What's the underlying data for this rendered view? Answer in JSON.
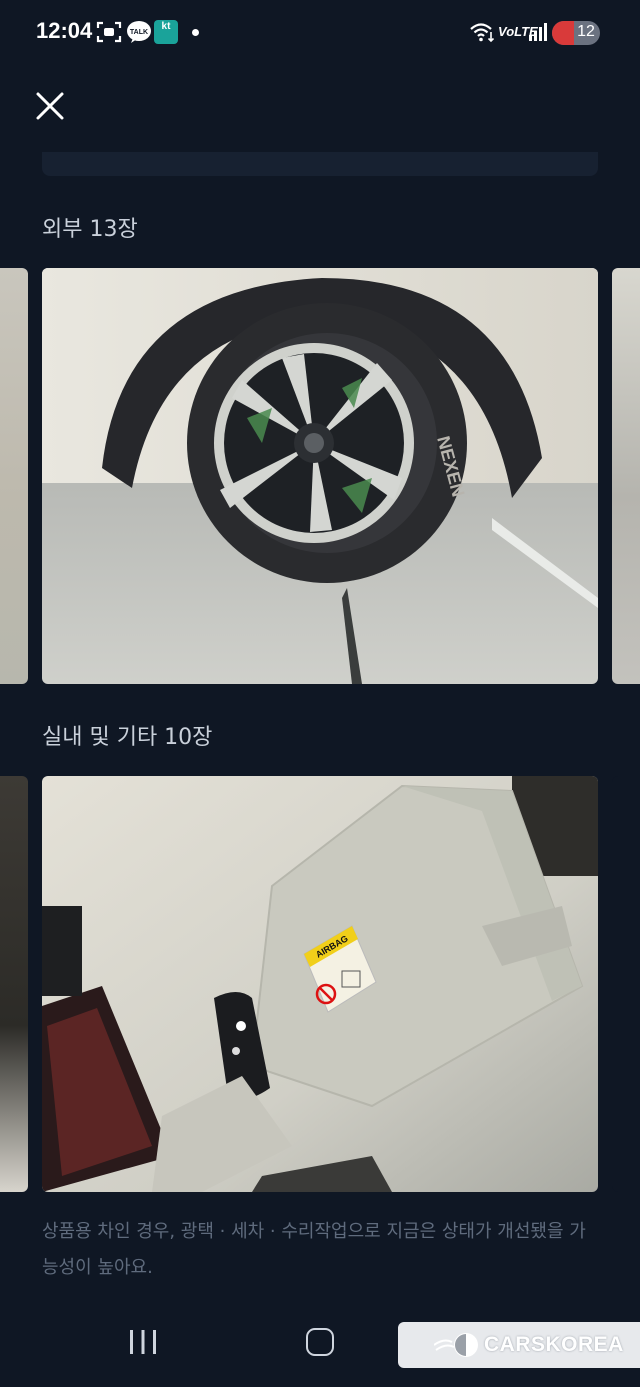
{
  "status_bar": {
    "time": "12:04",
    "app_icons": [
      "screenshot-icon",
      "kakaotalk-icon",
      "kt-icon"
    ],
    "talk_label": "TALK",
    "kt_label": "kt",
    "network": "VoLTE",
    "battery": "12",
    "colors": {
      "battery_low": "#d93a3a"
    }
  },
  "header": {
    "close_icon": "close-icon"
  },
  "sections": [
    {
      "title": "외부 13장",
      "photo": "tire-wheel-photo"
    },
    {
      "title": "실내 및 기타 10장",
      "photo": "interior-ceiling-photo"
    }
  ],
  "photo_labels": {
    "airbag": "AIRBAG",
    "tire_brand": "NEXEN"
  },
  "note": "상품용 차인 경우, 광택 · 세차 · 수리작업으로 지금은 상태가 개선됐을 가능성이 높아요.",
  "nav": [
    "recent-apps-button",
    "home-button"
  ],
  "watermark": {
    "text": "CARSKOREA"
  }
}
